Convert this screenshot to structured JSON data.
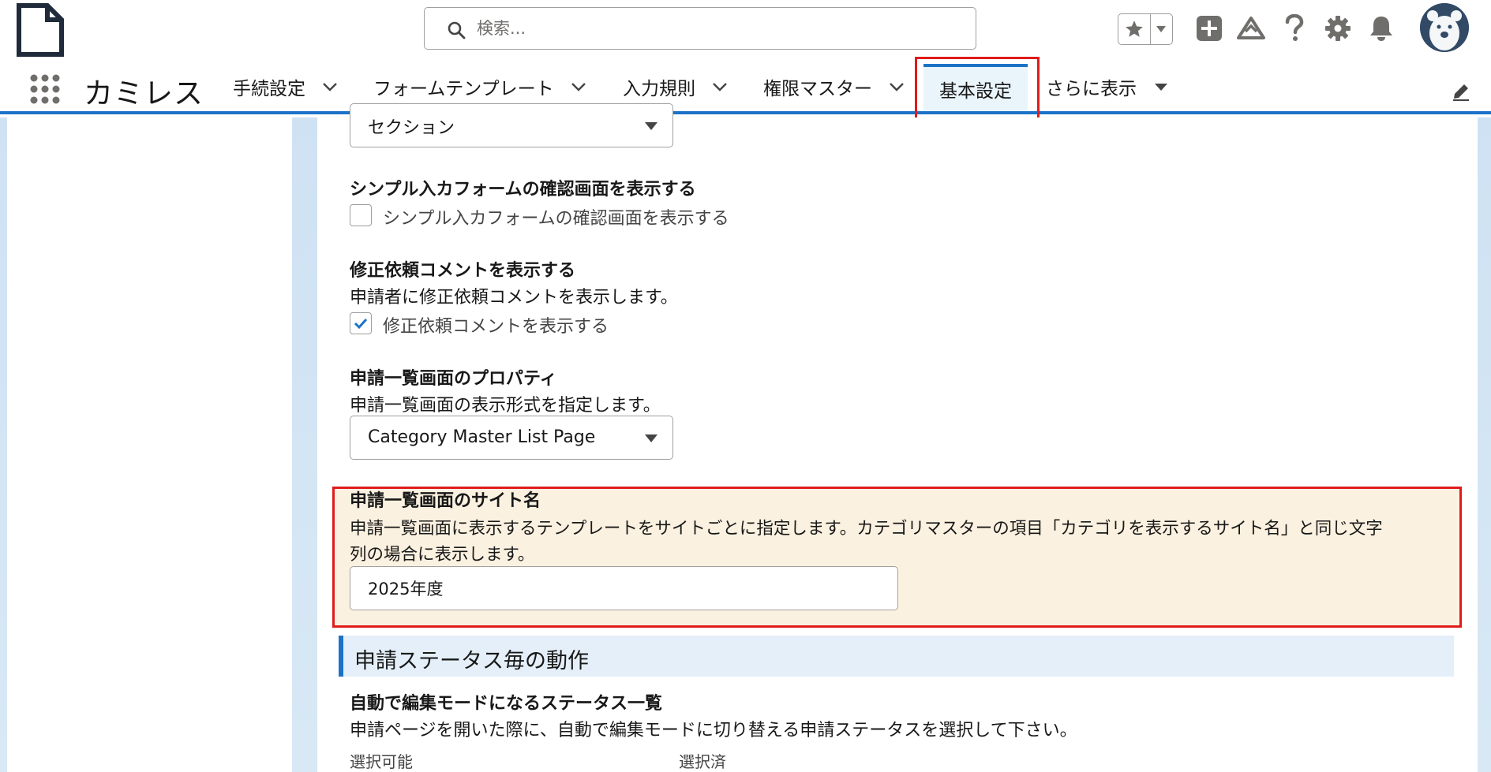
{
  "header": {
    "search": {
      "placeholder": "検索..."
    },
    "icons": [
      "file-icon",
      "search-icon",
      "star-icon",
      "chevron-down-icon",
      "plus-icon",
      "trailhead-icon",
      "help-icon",
      "gear-icon",
      "bell-icon",
      "avatar"
    ]
  },
  "nav": {
    "app_name": "カミレス",
    "items": [
      {
        "label": "手続設定"
      },
      {
        "label": "フォームテンプレート"
      },
      {
        "label": "入力規則"
      },
      {
        "label": "権限マスター"
      },
      {
        "label": "基本設定"
      },
      {
        "label": "さらに表示"
      }
    ]
  },
  "form": {
    "section_select": {
      "value": "セクション"
    },
    "simple_confirm": {
      "label": "シンプル入カフォームの確認画面を表示する",
      "checkbox_label": "シンプル入カフォームの確認画面を表示する",
      "checked": false
    },
    "revision_comment": {
      "label": "修正依頼コメントを表示する",
      "help": "申請者に修正依頼コメントを表示します。",
      "checkbox_label": "修正依頼コメントを表示する",
      "checked": true
    },
    "list_property": {
      "label": "申請一覧画面のプロパティ",
      "help": "申請一覧画面の表示形式を指定します。",
      "value": "Category Master List Page"
    },
    "site_name": {
      "label": "申請一覧画面のサイト名",
      "help_line1": "申請一覧画面に表示するテンプレートをサイトごとに指定します。カテゴリマスターの項目「カテゴリを表示するサイト名」と同じ文字",
      "help_line2": "列の場合に表示します。",
      "value": "2025年度"
    },
    "status_section": {
      "title": "申請ステータス毎の動作",
      "auto_edit_label": "自動で編集モードになるステータス一覧",
      "auto_edit_help": "申請ページを開いた際に、自動で編集モードに切り替える申請ステータスを選択して下さい。",
      "available": "選択可能",
      "selected": "選択済"
    }
  },
  "colors": {
    "accent": "#1b72c8",
    "highlight_border": "#e01b1b",
    "highlight_bg": "#fbf1e0"
  }
}
